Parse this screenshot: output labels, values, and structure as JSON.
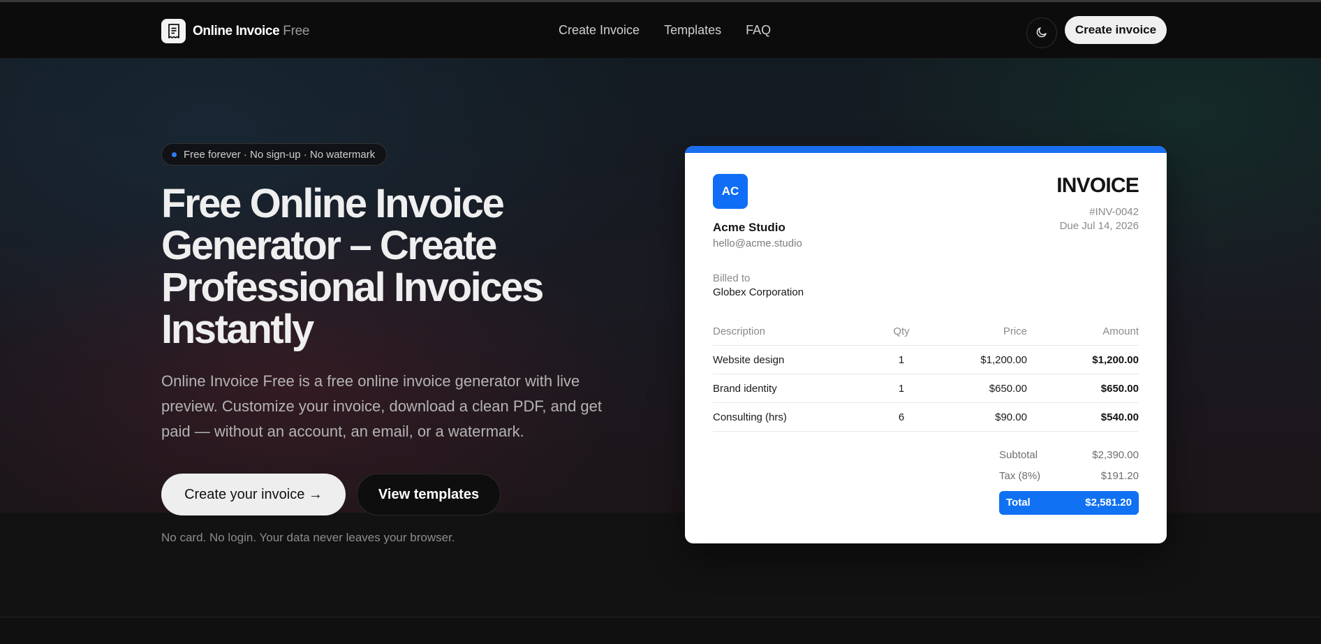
{
  "nav": {
    "brand_name": "Online Invoice",
    "brand_suffix": "Free",
    "links": [
      "Create Invoice",
      "Templates",
      "FAQ"
    ],
    "cta_label": "Create invoice"
  },
  "hero": {
    "badge": "Free forever · No sign-up · No watermark",
    "title": "Free Online Invoice Generator – Create Professional Invoices Instantly",
    "description": "Online Invoice Free is a free online invoice generator with live preview. Customize your invoice, download a clean PDF, and get paid — without an account, an email, or a watermark.",
    "primary_cta": "Create your invoice →",
    "secondary_cta": "View templates",
    "note": "No card. No login. Your data never leaves your browser."
  },
  "invoice": {
    "logo_initials": "AC",
    "company_name": "Acme Studio",
    "company_email": "hello@acme.studio",
    "title": "INVOICE",
    "number": "#INV-0042",
    "due": "Due Jul 14, 2026",
    "billed_label": "Billed to",
    "billed_name": "Globex Corporation",
    "columns": [
      "Description",
      "Qty",
      "Price",
      "Amount"
    ],
    "rows": [
      {
        "description": "Website design",
        "qty": "1",
        "price": "$1,200.00",
        "amount": "$1,200.00"
      },
      {
        "description": "Brand identity",
        "qty": "1",
        "price": "$650.00",
        "amount": "$650.00"
      },
      {
        "description": "Consulting (hrs)",
        "qty": "6",
        "price": "$90.00",
        "amount": "$540.00"
      }
    ],
    "subtotal_label": "Subtotal",
    "subtotal": "$2,390.00",
    "tax_label": "Tax (8%)",
    "tax": "$191.20",
    "total_label": "Total",
    "total": "$2,581.20"
  },
  "colors": {
    "accent": "#1071f2",
    "background": "#111111",
    "card": "#ffffff"
  },
  "icons": {
    "brand": "receipt-icon",
    "theme_toggle": "moon-icon",
    "badge": "status-dot-icon"
  }
}
